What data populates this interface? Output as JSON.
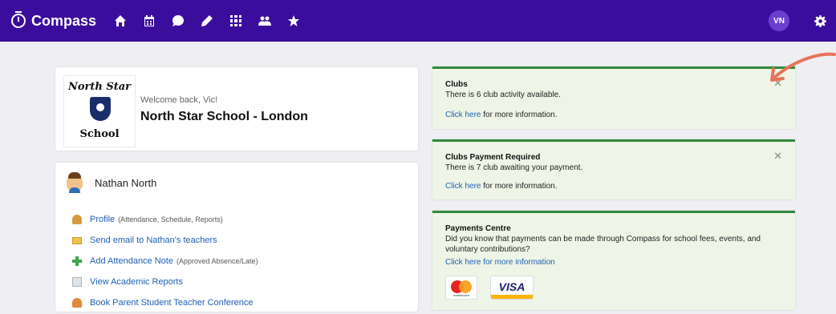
{
  "nav": {
    "brand": "Compass",
    "icons": [
      "home-icon",
      "calendar-icon",
      "chat-icon",
      "pencil-icon",
      "grid-icon",
      "people-icon",
      "star-icon"
    ],
    "avatar_initials": "VN",
    "colors": {
      "bar": "#3b0d9c",
      "avatar": "#6a3fd0"
    }
  },
  "school": {
    "logo_top": "North Star",
    "logo_bottom": "School",
    "welcome": "Welcome back, Vic!",
    "name": "North Star School - London"
  },
  "student": {
    "name": "Nathan North",
    "links": [
      {
        "label": "Profile",
        "note": "(Attendance, Schedule, Reports)"
      },
      {
        "label": "Send email to Nathan's teachers",
        "note": ""
      },
      {
        "label": "Add Attendance Note",
        "note": "(Approved Absence/Late)"
      },
      {
        "label": "View Academic Reports",
        "note": ""
      },
      {
        "label": "Book Parent Student Teacher Conference",
        "note": ""
      }
    ]
  },
  "notices": {
    "clubs": {
      "title": "Clubs",
      "body": "There is 6 club activity available.",
      "link": "Click here",
      "link_suffix": " for more information."
    },
    "payment_required": {
      "title": "Clubs Payment Required",
      "body": "There is 7 club awaiting your payment.",
      "link": "Click here",
      "link_suffix": " for more information."
    },
    "payments_centre": {
      "title": "Payments Centre",
      "body": "Did you know that payments can be made through Compass for school fees, events, and voluntary contributions?",
      "link": "Click here for more information",
      "mastercard_label": "mastercard",
      "visa_label": "VISA"
    },
    "close_glyph": "✕"
  },
  "colors": {
    "notice_border": "#2f8a3c",
    "notice_bg": "#eef5e6",
    "link": "#1d5fb3",
    "arrow": "#e8735a"
  }
}
